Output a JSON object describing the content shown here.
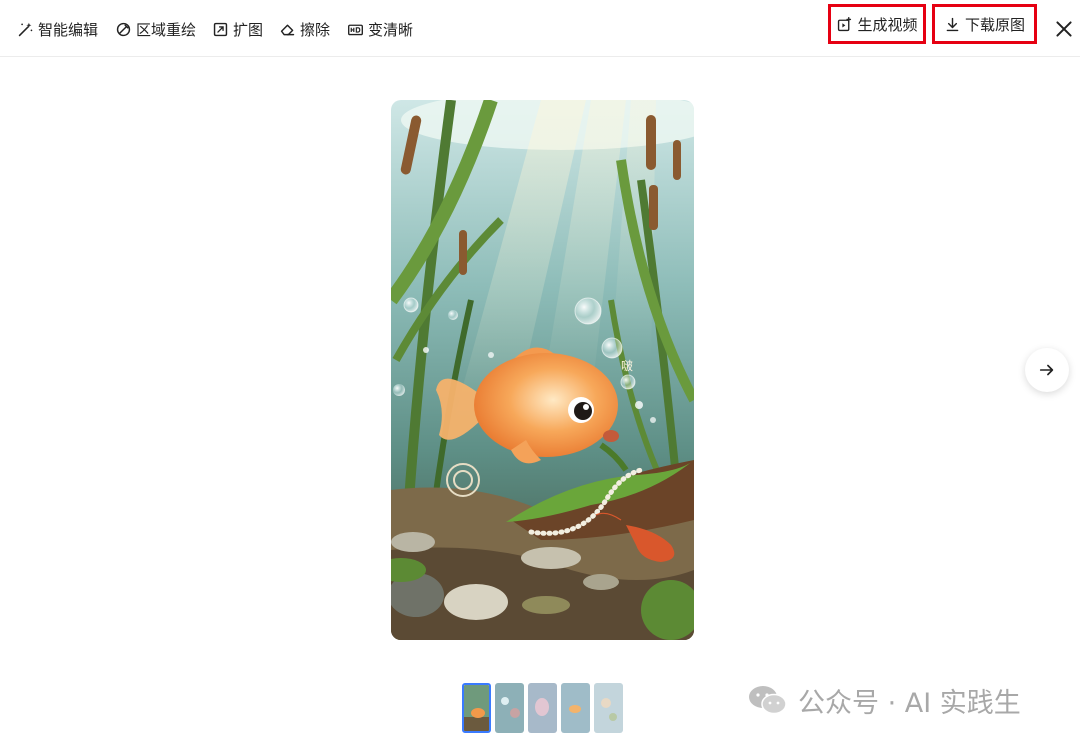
{
  "toolbar": {
    "tools": [
      {
        "label": "智能编辑",
        "icon": "magic-wand-icon"
      },
      {
        "label": "区域重绘",
        "icon": "region-redraw-icon"
      },
      {
        "label": "扩图",
        "icon": "expand-icon"
      },
      {
        "label": "擦除",
        "icon": "eraser-icon"
      },
      {
        "label": "变清晰",
        "icon": "hd-icon"
      }
    ],
    "generate_video_label": "生成视频",
    "download_label": "下载原图",
    "highlight_color": "#e60012"
  },
  "preview": {
    "bubble_text": "啵"
  },
  "thumbnails": {
    "count": 5,
    "active_index": 0
  },
  "watermark": {
    "text": "公众号 · AI 实践生",
    "icon": "wechat-icon"
  }
}
